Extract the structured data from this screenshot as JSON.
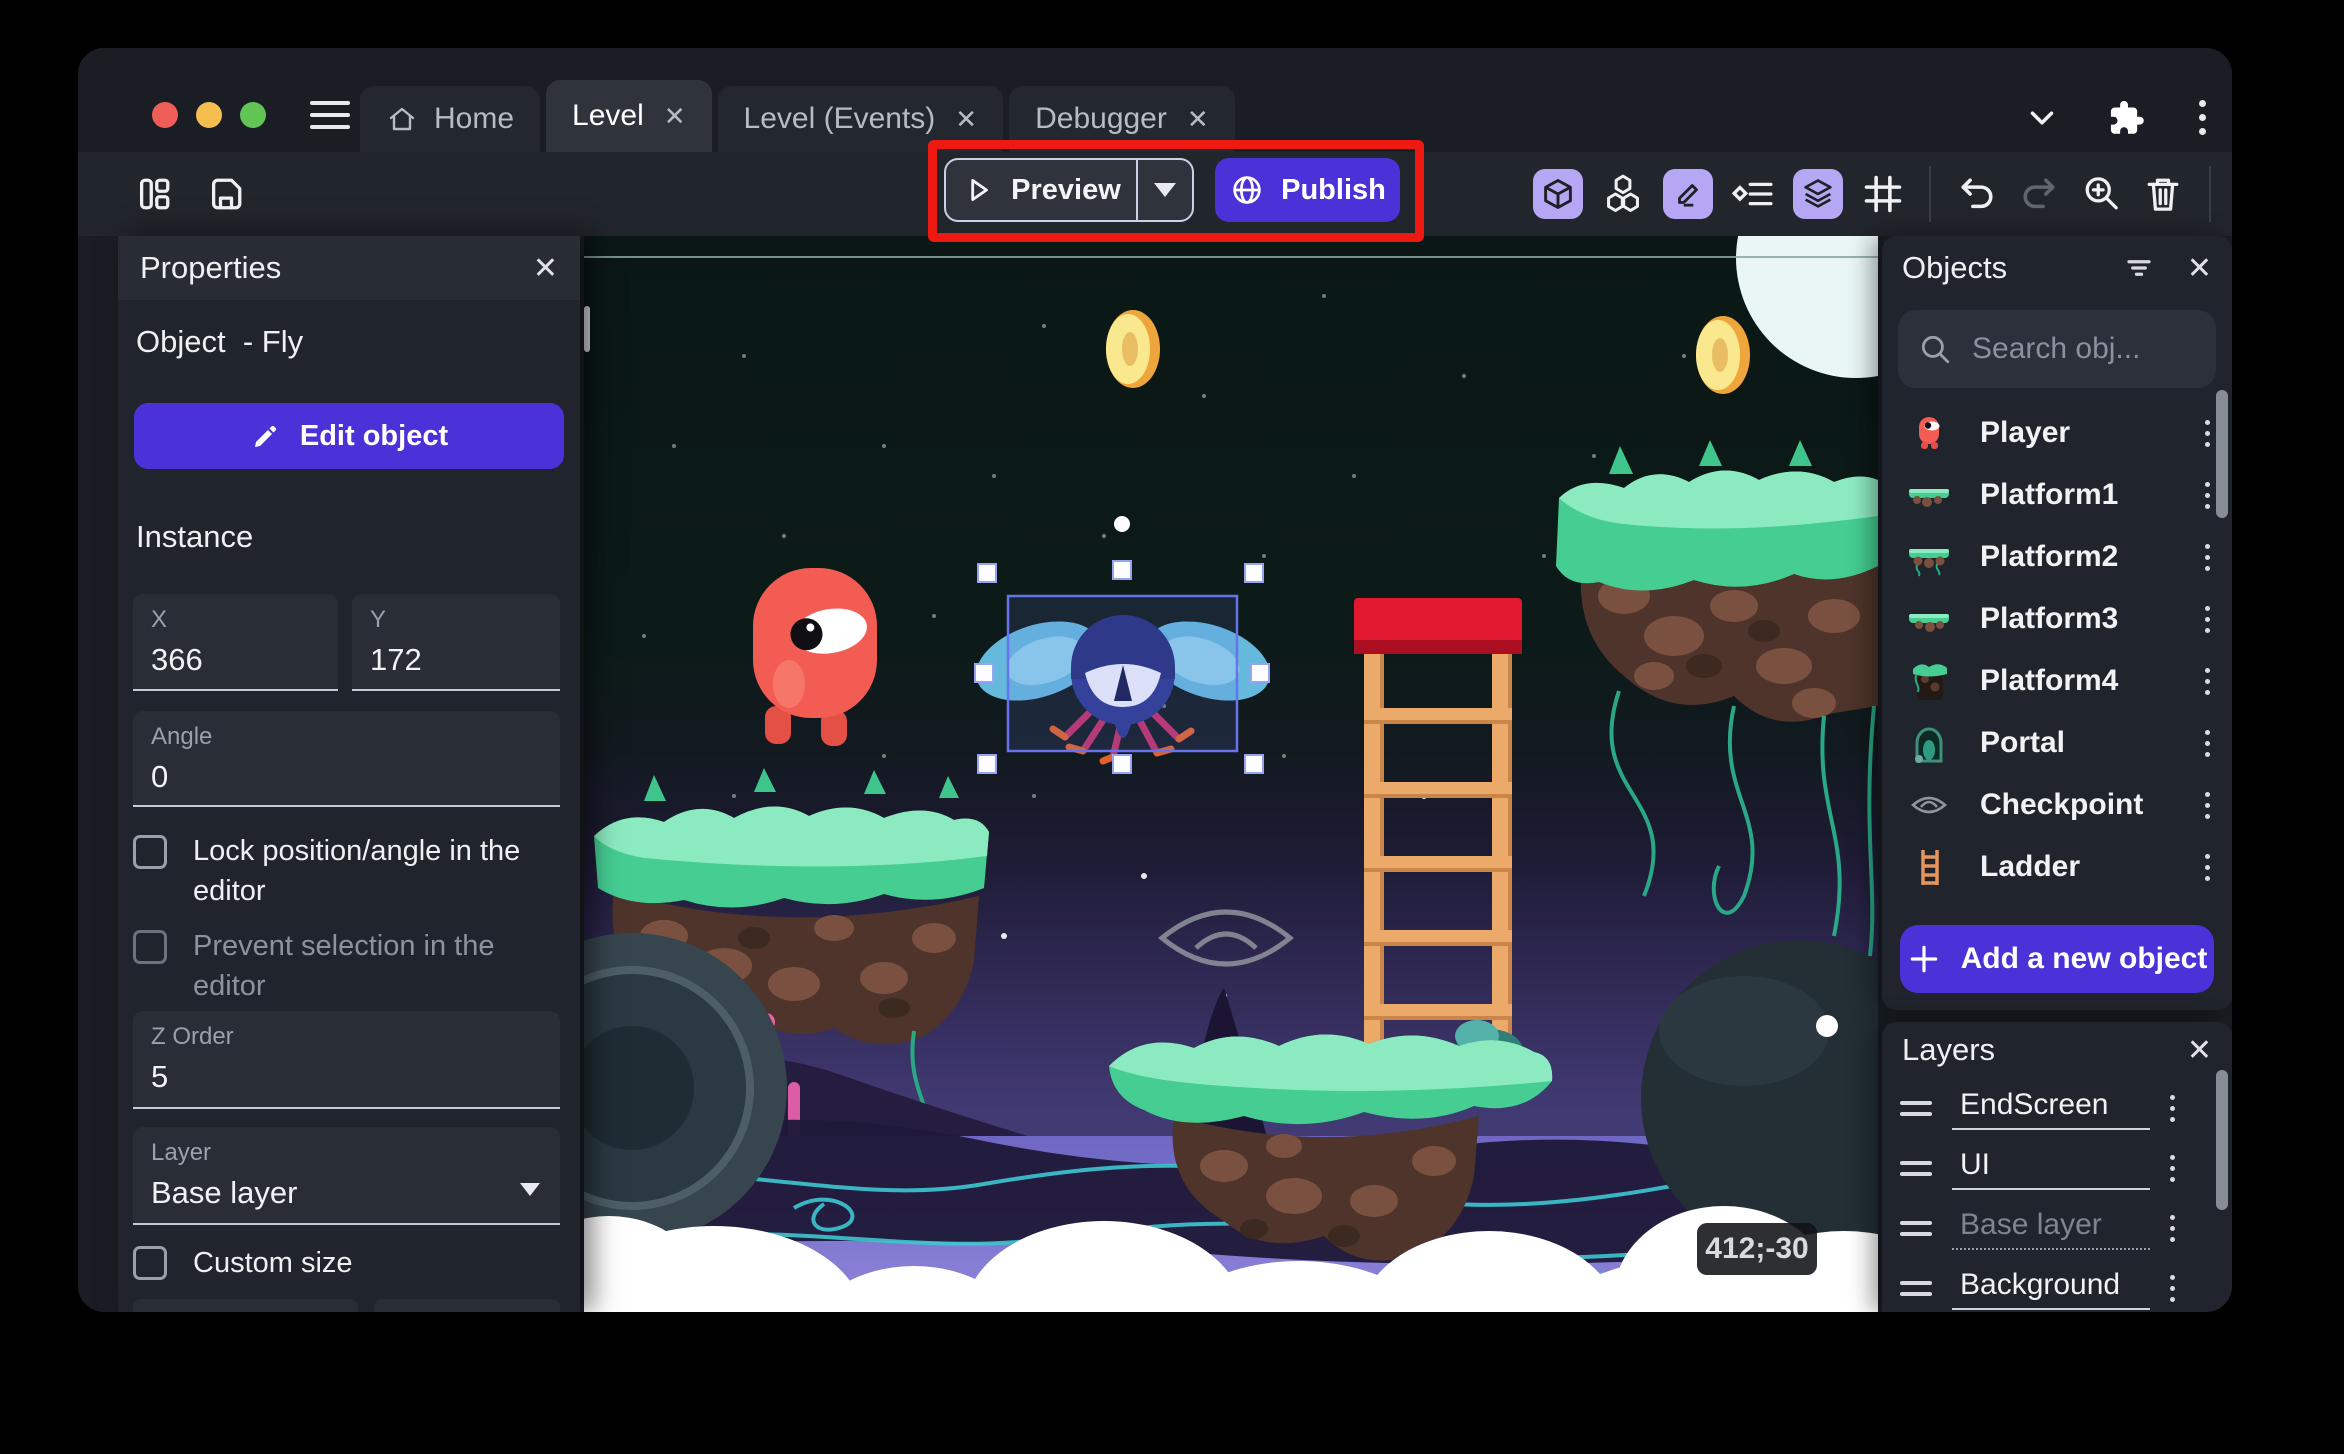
{
  "symbols": {
    "close": "✕"
  },
  "titlebar": {
    "tabs": [
      {
        "label": "Home",
        "active": false,
        "closable": false
      },
      {
        "label": "Level",
        "active": true,
        "closable": true
      },
      {
        "label": "Level (Events)",
        "active": false,
        "closable": true
      },
      {
        "label": "Debugger",
        "active": false,
        "closable": true
      }
    ]
  },
  "toolbar": {
    "preview_label": "Preview",
    "publish_label": "Publish",
    "icons": [
      "panels-left",
      "save",
      "objects-editor",
      "asset-store",
      "edit-mode",
      "instructions-list",
      "layers-editor",
      "grid",
      "undo",
      "redo",
      "zoom-in",
      "delete",
      "edit-scene-properties",
      "chevron-down",
      "extensions",
      "more-options"
    ]
  },
  "properties_panel": {
    "title": "Properties",
    "object_title": "Object  - Fly",
    "edit_object_label": "Edit object",
    "instance_label": "Instance",
    "fields": {
      "x_label": "X",
      "x_value": "366",
      "y_label": "Y",
      "y_value": "172",
      "angle_label": "Angle",
      "angle_value": "0",
      "z_order_label": "Z Order",
      "z_order_value": "5",
      "layer_label": "Layer",
      "layer_value": "Base layer"
    },
    "checkboxes": {
      "lock": "Lock position/angle in the editor",
      "prevent": "Prevent selection in the editor",
      "custom_size": "Custom size"
    }
  },
  "objects_panel": {
    "title": "Objects",
    "search_placeholder": "Search obj...",
    "items": [
      {
        "name": "Player",
        "icon": "player-sprite"
      },
      {
        "name": "Platform1",
        "icon": "platform-sprite"
      },
      {
        "name": "Platform2",
        "icon": "platform-vines-sprite"
      },
      {
        "name": "Platform3",
        "icon": "platform-sprite"
      },
      {
        "name": "Platform4",
        "icon": "tall-platform-sprite"
      },
      {
        "name": "Portal",
        "icon": "portal-sprite"
      },
      {
        "name": "Checkpoint",
        "icon": "checkpoint-eye-sprite"
      },
      {
        "name": "Ladder",
        "icon": "ladder-sprite"
      }
    ],
    "add_button_label": "Add a new object"
  },
  "layers_panel": {
    "title": "Layers",
    "layers": [
      {
        "name": "EndScreen"
      },
      {
        "name": "UI"
      },
      {
        "name": "Base layer",
        "dimmed": true
      },
      {
        "name": "Background"
      }
    ]
  },
  "canvas": {
    "cursor_coordinates": "412;-30",
    "selected_instance": "Fly"
  },
  "colors": {
    "accent_purple": "#4b31d8",
    "toolbar_chip_lavender": "#b6a7f4",
    "highlight_red": "#ee1a12",
    "selection_blue": "#6673ea",
    "coin_gold": "#f9e88e",
    "grass_green": "#45cd92"
  }
}
